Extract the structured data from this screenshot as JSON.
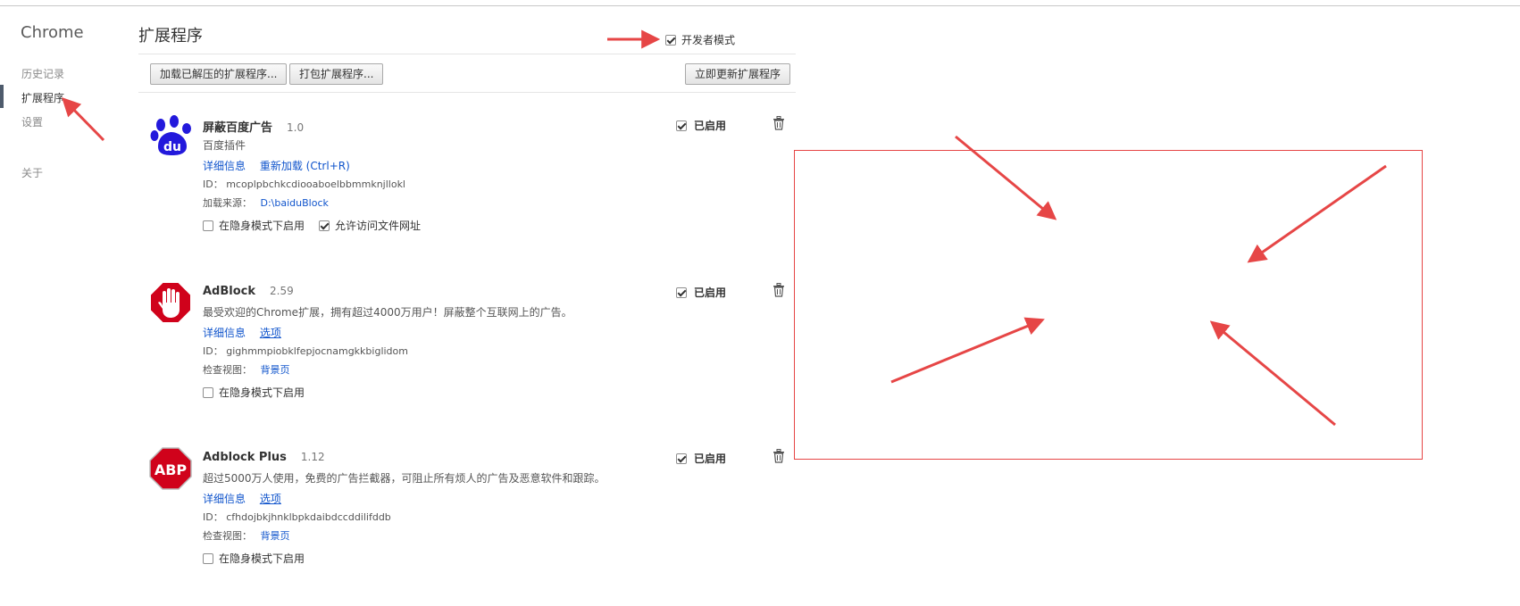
{
  "sidebar": {
    "brand": "Chrome",
    "items": [
      {
        "label": "历史记录"
      },
      {
        "label": "扩展程序"
      },
      {
        "label": "设置"
      },
      {
        "label": "关于"
      }
    ]
  },
  "header": {
    "title": "扩展程序",
    "dev_mode_label": "开发者模式",
    "dev_mode_checked": true
  },
  "toolbar": {
    "load_unpacked": "加载已解压的扩展程序...",
    "pack": "打包扩展程序...",
    "update_now": "立即更新扩展程序"
  },
  "extensions": [
    {
      "icon": "baidu-paw-icon",
      "name": "屏蔽百度广告",
      "version": "1.0",
      "description": "百度插件",
      "link1": "详细信息",
      "link2": "重新加载 (Ctrl+R)",
      "id_label": "ID：",
      "id_value": "mcoplpbchkcdiooaboelbbmmknjllokl",
      "extra_label": "加载来源：",
      "extra_value": "D:\\baiduBlock",
      "incognito_label": "在隐身模式下启用",
      "file_access_label": "允许访问文件网址",
      "enabled_label": "已启用"
    },
    {
      "icon": "adblock-hand-icon",
      "name": "AdBlock",
      "version": "2.59",
      "description": "最受欢迎的Chrome扩展，拥有超过4000万用户！屏蔽整个互联网上的广告。",
      "link1": "详细信息",
      "link2": "选项",
      "id_label": "ID：",
      "id_value": "gighmmpiobklfepjocnamgkkbiglidom",
      "extra_label": "检查视图：",
      "extra_value": "背景页",
      "incognito_label": "在隐身模式下启用",
      "enabled_label": "已启用"
    },
    {
      "icon": "abp-octagon-icon",
      "name": "Adblock Plus",
      "version": "1.12",
      "description": "超过5000万人使用，免费的广告拦截器，可阻止所有烦人的广告及恶意软件和跟踪。",
      "link1": "详细信息",
      "link2": "选项",
      "id_label": "ID：",
      "id_value": "cfhdojbkjhnklbpkdaibdccddilifddb",
      "extra_label": "检查视图：",
      "extra_value": "背景页",
      "incognito_label": "在隐身模式下启用",
      "enabled_label": "已启用"
    }
  ],
  "abp_logo_text": "ABP",
  "baidu_logo_text": "du",
  "colors": {
    "link": "#1155cc",
    "annotation_red": "#e64646",
    "baidu_blue": "#2319dc",
    "adblock_red": "#d0021b"
  }
}
